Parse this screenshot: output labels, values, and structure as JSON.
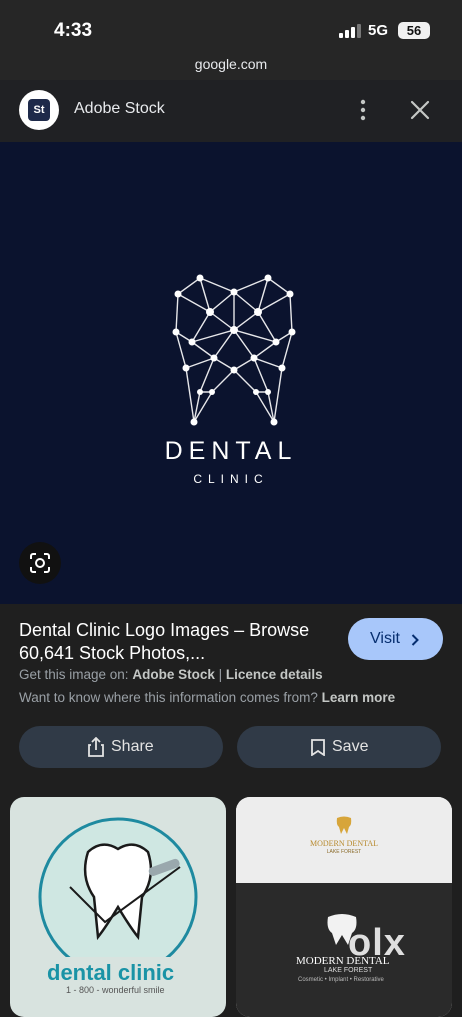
{
  "status": {
    "time": "4:33",
    "network": "5G",
    "battery": "56"
  },
  "browser": {
    "url": "google.com"
  },
  "header": {
    "site_name": "Adobe Stock",
    "logo_text": "St"
  },
  "image": {
    "brand_line1": "DENTAL",
    "brand_line2": "CLINIC"
  },
  "result": {
    "title": "Dental Clinic Logo Images – Browse 60,641 Stock Photos,...",
    "visit_label": "Visit",
    "source_prefix": "Get this image on:",
    "source_name": "Adobe Stock",
    "separator": "|",
    "licence_label": "Licence details",
    "info_text": "Want to know where this information comes from?",
    "learn_more": "Learn more"
  },
  "actions": {
    "share_label": "Share",
    "save_label": "Save"
  },
  "thumbs": [
    {
      "title": "dental clinic",
      "subtitle": "1 - 800 - wonderful smile"
    },
    {
      "line1": "MODERN DENTAL",
      "line2": "LAKE FOREST",
      "line3": "MODERN DENTAL",
      "line4": "LAKE FOREST",
      "line5": "Cosmetic • Implant • Restorative"
    }
  ],
  "watermark": "olx",
  "colors": {
    "accent": "#a8c7fa",
    "image_bg": "#0b132e",
    "button_bg": "#303a47"
  }
}
